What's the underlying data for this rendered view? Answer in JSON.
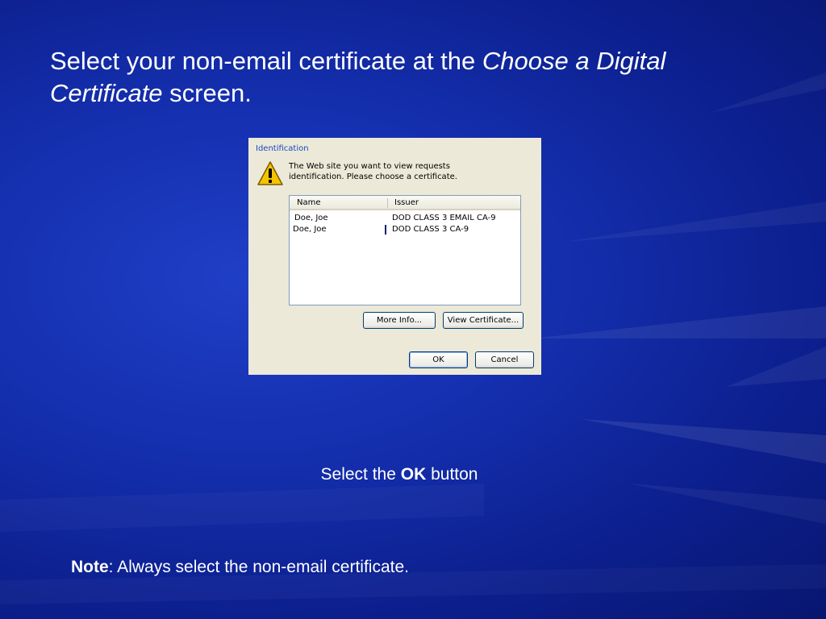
{
  "slide": {
    "title_part1": "Select your non-email certificate at the ",
    "title_italic": "Choose a Digital Certificate",
    "title_part2": " screen.",
    "instruction_prefix": "Select the ",
    "instruction_bold": "OK",
    "instruction_suffix": " button",
    "note_bold": "Note",
    "note_text": ": Always select the non-email certificate."
  },
  "dialog": {
    "title": "Identification",
    "message": "The Web site you want to view requests\nidentification. Please choose a certificate.",
    "icon": "warning-icon",
    "columns": {
      "name": "Name",
      "issuer": "Issuer"
    },
    "rows": [
      {
        "name": "Doe, Joe",
        "issuer": "DOD CLASS 3 EMAIL CA-9"
      },
      {
        "name": "Doe, Joe",
        "issuer": "DOD CLASS 3 CA-9"
      }
    ],
    "buttons": {
      "more_info": "More Info...",
      "view_certificate": "View Certificate...",
      "ok": "OK",
      "cancel": "Cancel"
    }
  },
  "colors": {
    "background": "#1530b0",
    "dialog_face": "#ece9d8",
    "dialog_title": "#1c47c8",
    "button_border": "#003c74"
  }
}
